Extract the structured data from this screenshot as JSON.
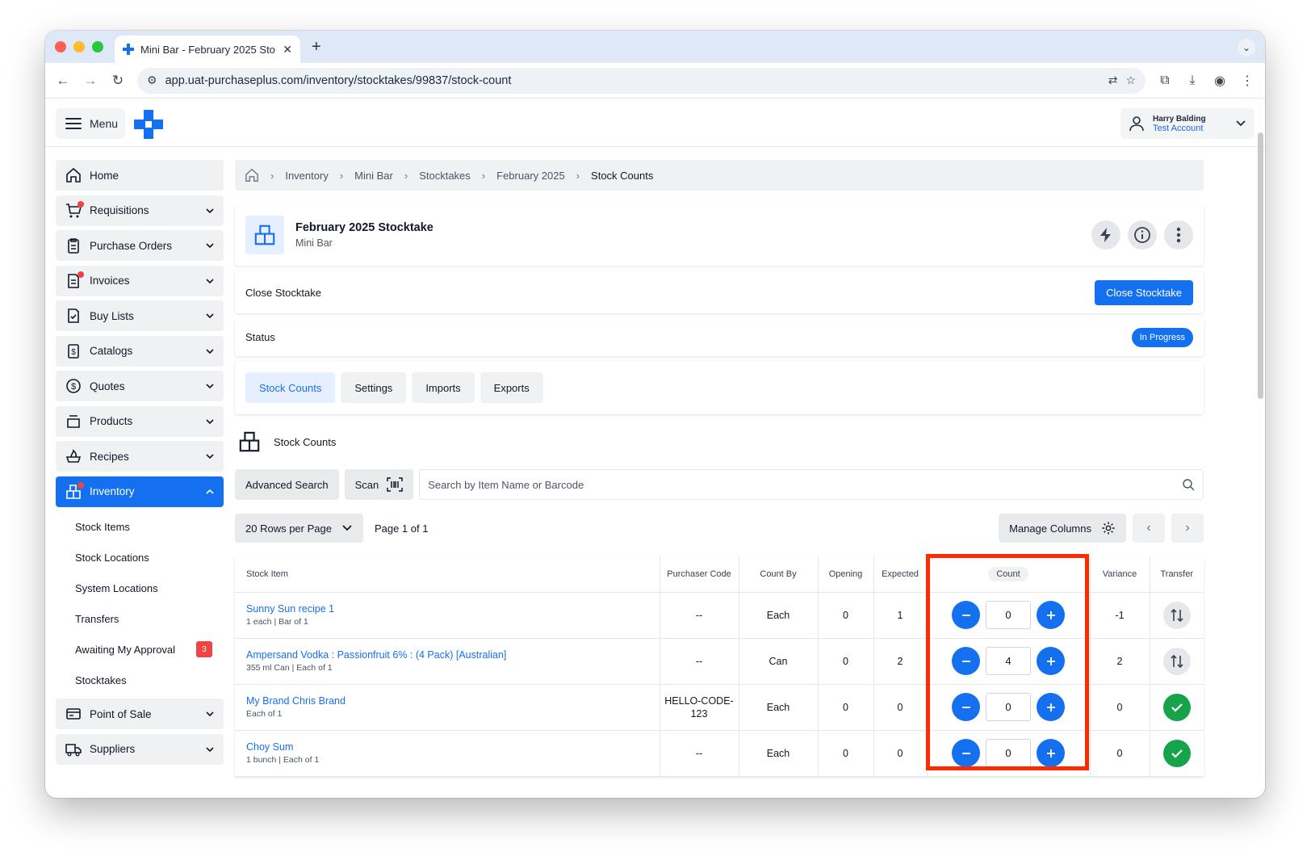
{
  "browser": {
    "tab_title": "Mini Bar - February 2025 Sto",
    "url_domain": "app.uat-purchaseplus.com",
    "url_path": "/inventory/stocktakes/99837/stock-count"
  },
  "header": {
    "menu_label": "Menu",
    "user_name": "Harry Balding",
    "user_account": "Test Account"
  },
  "sidebar": {
    "items": [
      {
        "label": "Home",
        "icon": "home-icon"
      },
      {
        "label": "Requisitions",
        "icon": "cart-icon"
      },
      {
        "label": "Purchase Orders",
        "icon": "clipboard-icon"
      },
      {
        "label": "Invoices",
        "icon": "invoice-icon"
      },
      {
        "label": "Buy Lists",
        "icon": "checklist-icon"
      },
      {
        "label": "Catalogs",
        "icon": "catalog-icon"
      },
      {
        "label": "Quotes",
        "icon": "dollar-icon"
      },
      {
        "label": "Products",
        "icon": "products-icon"
      },
      {
        "label": "Recipes",
        "icon": "recipes-icon"
      },
      {
        "label": "Inventory",
        "icon": "inventory-icon"
      }
    ],
    "inventory_sub": [
      "Stock Items",
      "Stock Locations",
      "System Locations",
      "Transfers",
      "Awaiting My Approval",
      "Stocktakes"
    ],
    "awaiting_count": "3",
    "bottom_items": [
      {
        "label": "Point of Sale",
        "icon": "pos-icon"
      },
      {
        "label": "Suppliers",
        "icon": "truck-icon"
      }
    ]
  },
  "breadcrumb": [
    "Inventory",
    "Mini Bar",
    "Stocktakes",
    "February 2025",
    "Stock Counts"
  ],
  "page": {
    "title": "February 2025 Stocktake",
    "subtitle": "Mini Bar",
    "close_label": "Close Stocktake",
    "close_button": "Close Stocktake",
    "status_label": "Status",
    "status_value": "In Progress",
    "tabs": [
      "Stock Counts",
      "Settings",
      "Imports",
      "Exports"
    ],
    "section_title": "Stock Counts",
    "advanced_search": "Advanced Search",
    "scan": "Scan",
    "search_placeholder": "Search by Item Name or Barcode",
    "rows_per_page": "20 Rows per Page",
    "page_info": "Page 1 of 1",
    "manage_columns": "Manage Columns"
  },
  "table": {
    "headers": {
      "item": "Stock Item",
      "code": "Purchaser Code",
      "countby": "Count By",
      "opening": "Opening",
      "expected": "Expected",
      "count": "Count",
      "variance": "Variance",
      "transfer": "Transfer"
    },
    "rows": [
      {
        "name": "Sunny Sun recipe 1",
        "sub": "1 each | Bar of 1",
        "code": "--",
        "countby": "Each",
        "opening": "0",
        "expected": "1",
        "count": "0",
        "variance": "-1",
        "transfer": "transfer"
      },
      {
        "name": "Ampersand Vodka : Passionfruit 6% : (4 Pack) [Australian]",
        "sub": "355 ml Can | Each of 1",
        "code": "--",
        "countby": "Can",
        "opening": "0",
        "expected": "2",
        "count": "4",
        "variance": "2",
        "transfer": "transfer"
      },
      {
        "name": "My Brand Chris Brand",
        "sub": "Each of 1",
        "code": "HELLO-CODE-123",
        "countby": "Each",
        "opening": "0",
        "expected": "0",
        "count": "0",
        "variance": "0",
        "transfer": "ok"
      },
      {
        "name": "Choy Sum",
        "sub": "1 bunch | Each of 1",
        "code": "--",
        "countby": "Each",
        "opening": "0",
        "expected": "0",
        "count": "0",
        "variance": "0",
        "transfer": "ok"
      }
    ]
  },
  "colors": {
    "accent": "#1570ef",
    "highlight": "#ff2a00",
    "success": "#16a34a"
  }
}
